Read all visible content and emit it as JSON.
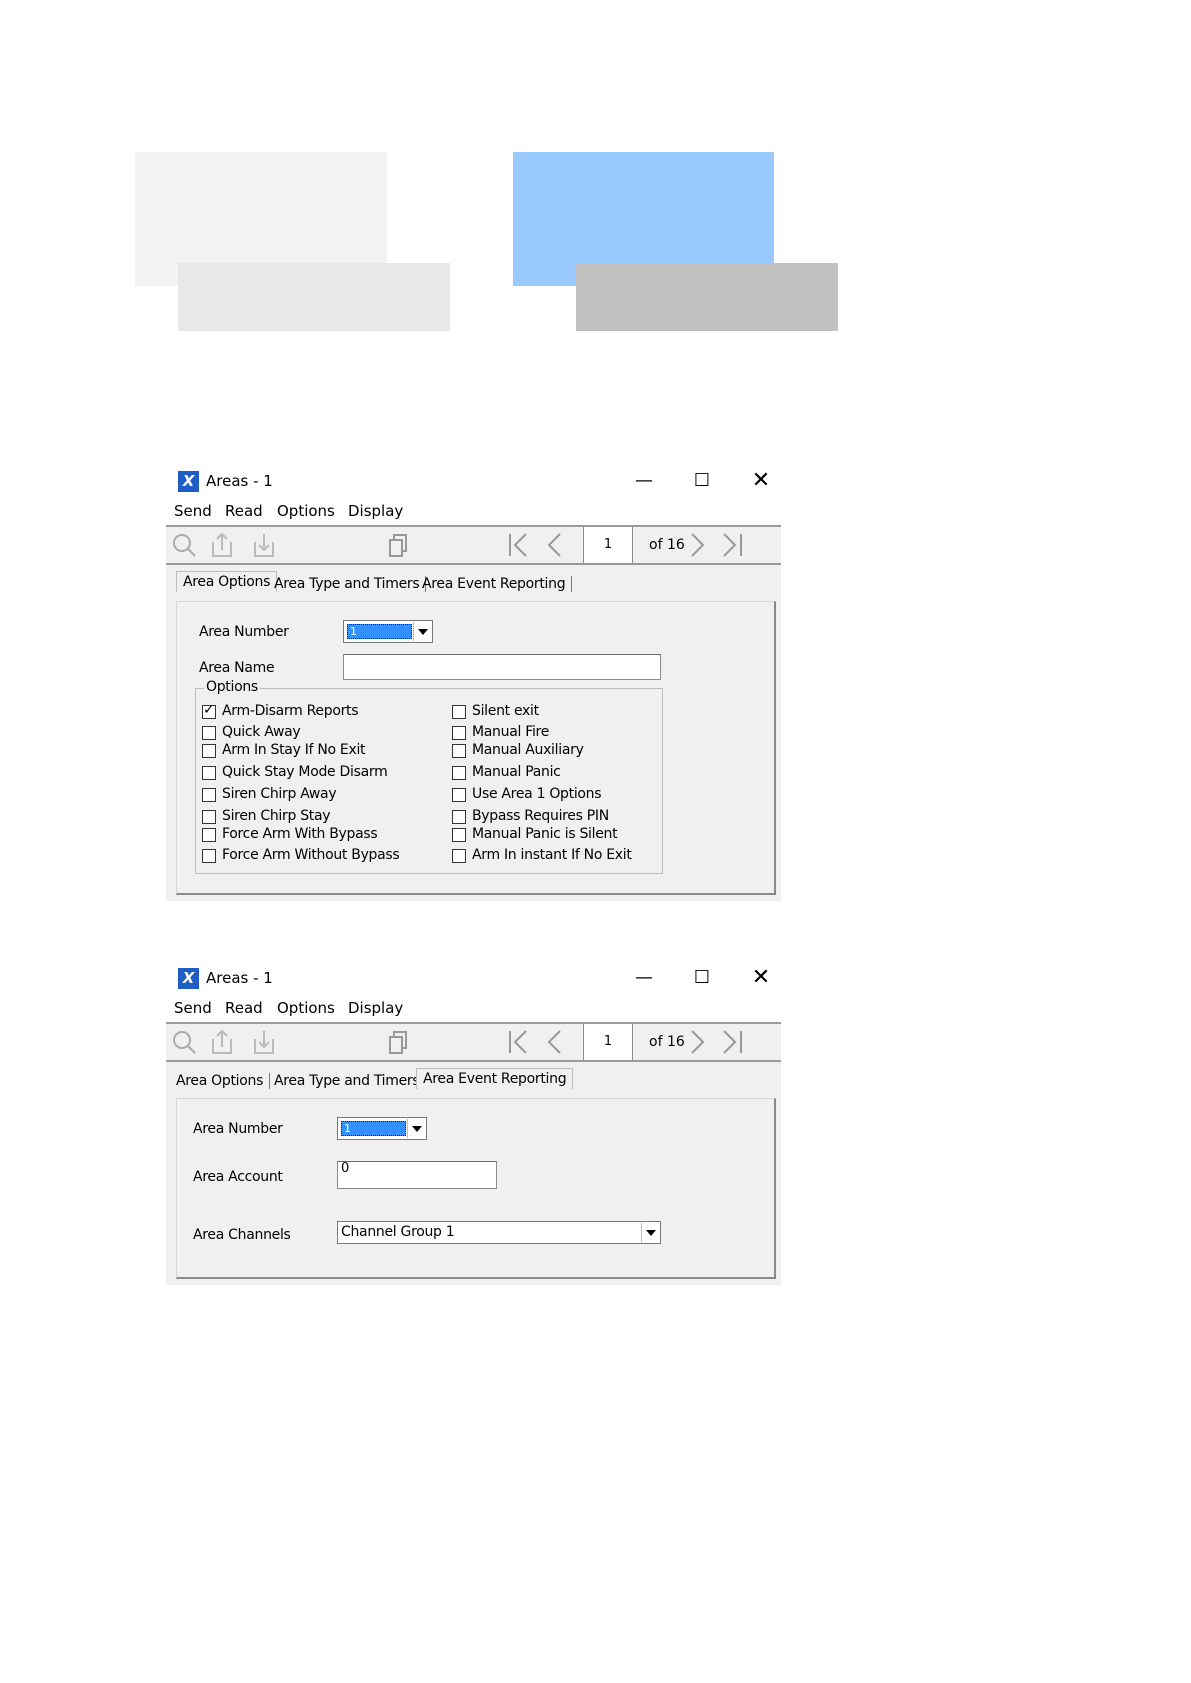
{
  "colors": {
    "block_light": "#f2f2f2",
    "block_mid": "#e8e8e8",
    "block_blue": "#99c9ff",
    "block_gray": "#c2c2c2",
    "title_icon": "#1f5dc6",
    "selection": "#3391ff"
  },
  "window1": {
    "title": "Areas - 1",
    "menu": [
      "Send",
      "Read",
      "Options",
      "Display"
    ],
    "pager": {
      "current": "1",
      "total_text": "of 16"
    },
    "tabs": [
      "Area Options",
      "Area Type and Timers",
      "Area Event Reporting"
    ],
    "active_tab": "Area Options",
    "area_number_label": "Area Number",
    "area_number_value": "1",
    "area_name_label": "Area Name",
    "area_name_value": "",
    "options_legend": "Options",
    "options_left": [
      {
        "label": "Arm-Disarm Reports",
        "checked": true
      },
      {
        "label": "Quick Away",
        "checked": false
      },
      {
        "label": "Arm In Stay If No Exit",
        "checked": false
      },
      {
        "label": "Quick Stay Mode Disarm",
        "checked": false
      },
      {
        "label": "Siren Chirp Away",
        "checked": false
      },
      {
        "label": "Siren Chirp Stay",
        "checked": false
      },
      {
        "label": "Force Arm With Bypass",
        "checked": false
      },
      {
        "label": "Force Arm Without Bypass",
        "checked": false
      }
    ],
    "options_right": [
      {
        "label": "Silent exit",
        "checked": false
      },
      {
        "label": "Manual Fire",
        "checked": false
      },
      {
        "label": "Manual Auxiliary",
        "checked": false
      },
      {
        "label": "Manual Panic",
        "checked": false
      },
      {
        "label": "Use Area 1 Options",
        "checked": false
      },
      {
        "label": "Bypass Requires PIN",
        "checked": false
      },
      {
        "label": "Manual Panic is Silent",
        "checked": false
      },
      {
        "label": "Arm In instant If No Exit",
        "checked": false
      }
    ]
  },
  "window2": {
    "title": "Areas - 1",
    "menu": [
      "Send",
      "Read",
      "Options",
      "Display"
    ],
    "pager": {
      "current": "1",
      "total_text": "of 16"
    },
    "tabs": [
      "Area Options",
      "Area Type and Timers",
      "Area Event Reporting"
    ],
    "active_tab": "Area Event Reporting",
    "area_number_label": "Area Number",
    "area_number_value": "1",
    "area_account_label": "Area Account",
    "area_account_value": "0",
    "area_channels_label": "Area Channels",
    "area_channels_value": "Channel Group 1"
  }
}
